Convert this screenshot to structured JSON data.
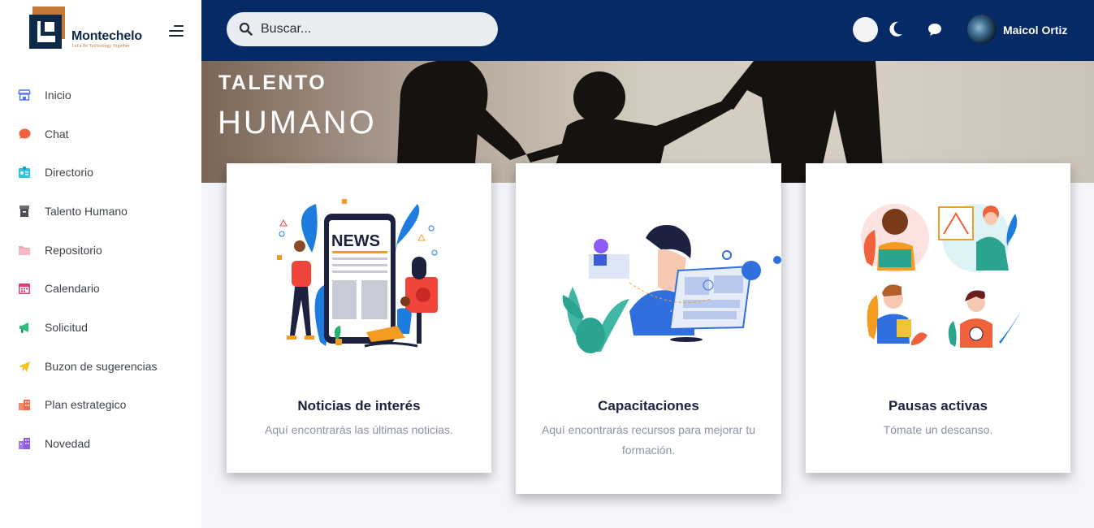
{
  "brand": {
    "name": "Montechelo",
    "tagline": "Let's Be Technology Together"
  },
  "sidebar": {
    "items": [
      {
        "label": "Inicio",
        "icon": "store-icon",
        "color": "#5b6ff2"
      },
      {
        "label": "Chat",
        "icon": "chat-bubble-icon",
        "color": "#f0623c"
      },
      {
        "label": "Directorio",
        "icon": "id-card-icon",
        "color": "#2fc3e4"
      },
      {
        "label": "Talento Humano",
        "icon": "archive-box-icon",
        "color": "#4b4f55"
      },
      {
        "label": "Repositorio",
        "icon": "folder-icon",
        "color": "#f4a5b2"
      },
      {
        "label": "Calendario",
        "icon": "calendar-icon",
        "color": "#e23d6b"
      },
      {
        "label": "Solicitud",
        "icon": "megaphone-icon",
        "color": "#28c07a"
      },
      {
        "label": "Buzon de sugerencias",
        "icon": "paper-plane-icon",
        "color": "#f6c21c"
      },
      {
        "label": "Plan estrategico",
        "icon": "building-icon",
        "color": "#f06b4b"
      },
      {
        "label": "Novedad",
        "icon": "city-icon",
        "color": "#8f5be0"
      }
    ]
  },
  "header": {
    "search_placeholder": "Buscar...",
    "user_name": "Maicol Ortiz",
    "bar_color": "#052a65"
  },
  "banner": {
    "line1": "TALENTO",
    "line2": "HUMANO"
  },
  "cards": [
    {
      "title": "Noticias de interés",
      "description": "Aquí encontrarás las últimas noticias.",
      "illustration": "news-illustration"
    },
    {
      "title": "Capacitaciones",
      "description": "Aquí encontrarás recursos para mejorar tu formación.",
      "illustration": "training-illustration"
    },
    {
      "title": "Pausas activas",
      "description": "Tómate un descanso.",
      "illustration": "active-breaks-illustration"
    }
  ]
}
